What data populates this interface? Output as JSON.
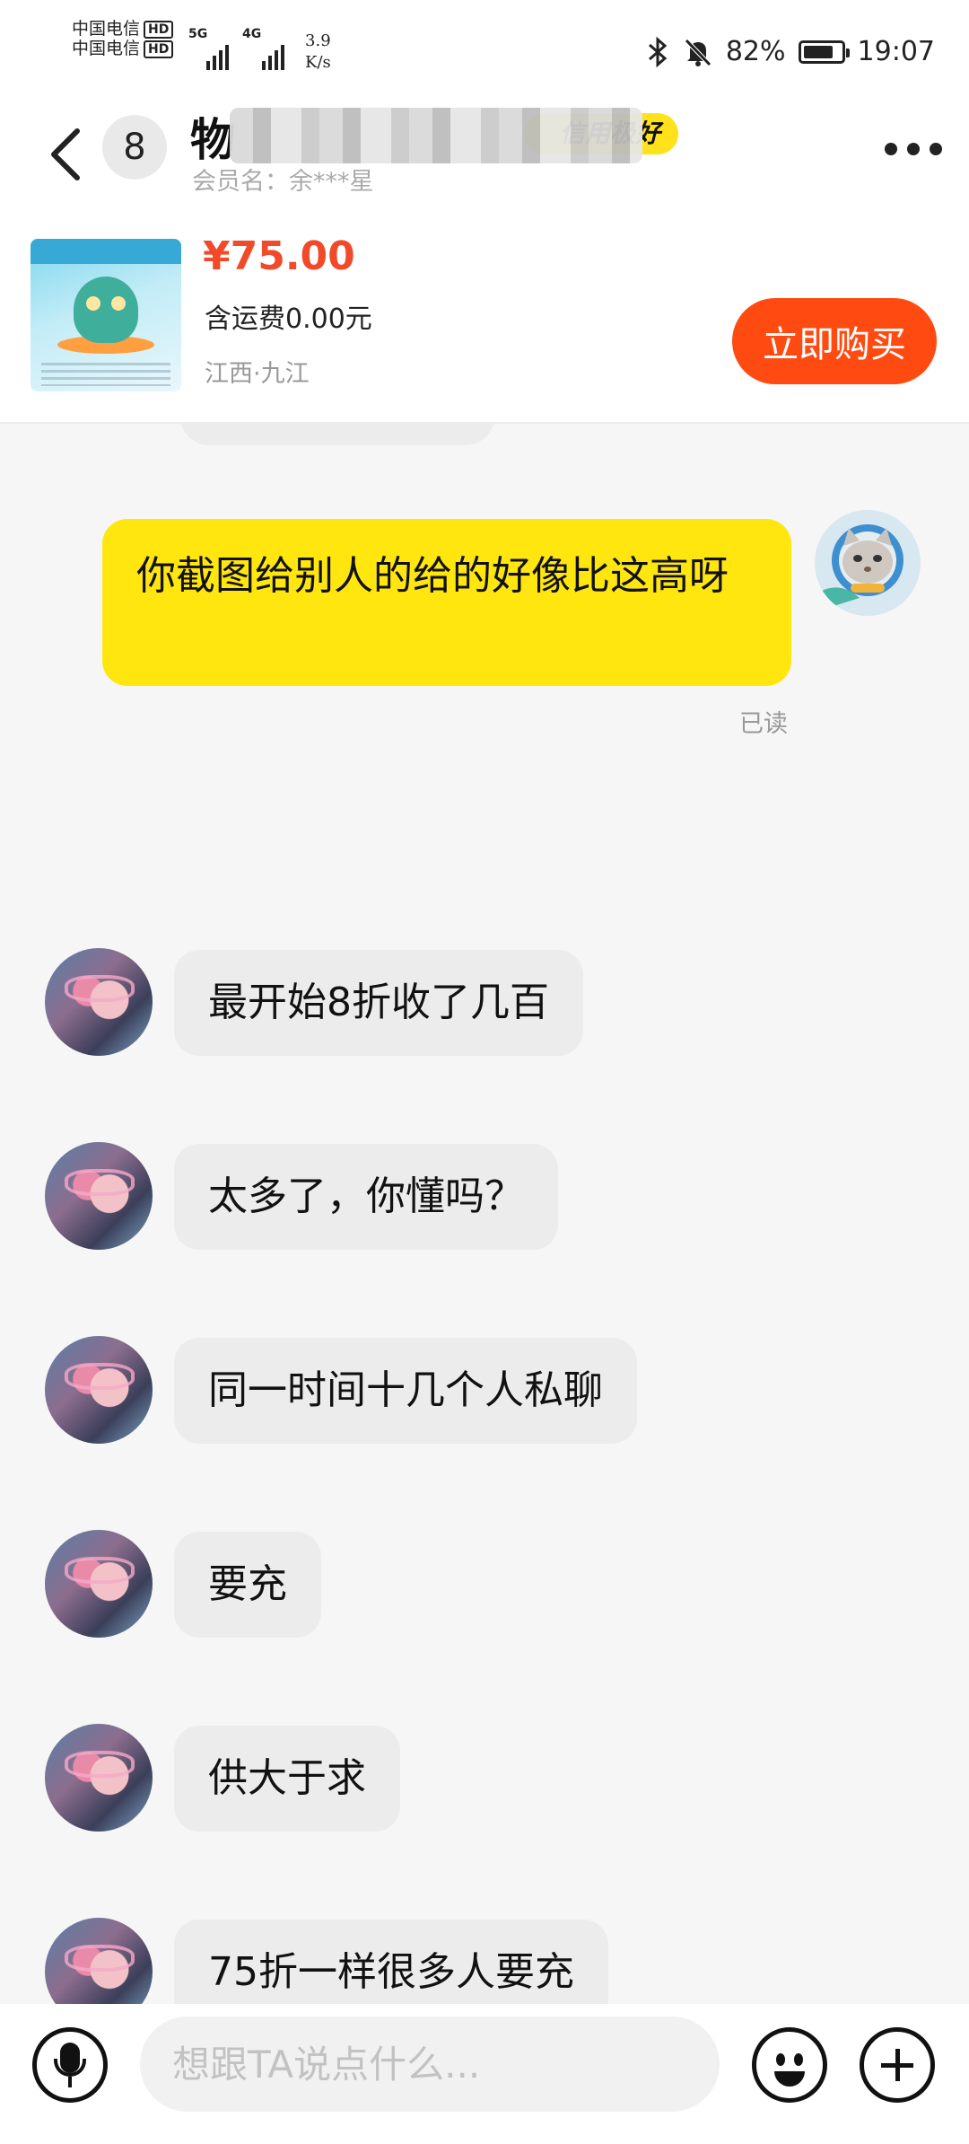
{
  "status_bar": {
    "carrier_1": "中国电信",
    "carrier_2": "中国电信",
    "hd_label": "HD",
    "net_1": "5G",
    "net_2": "4G",
    "speed_value": "3.9",
    "speed_unit": "K/s",
    "battery_level": "82%",
    "battery_fraction": 0.82,
    "time": "19:07"
  },
  "header": {
    "unread_count": "8",
    "title_visible": "物",
    "credit_badge": "信用极好",
    "member_name": "会员名：余***星"
  },
  "product": {
    "price": "¥75.00",
    "shipping": "含运费0.00元",
    "location": "江西·九江",
    "buy_label": "立即购买"
  },
  "chat": {
    "my_message": "你截图给别人的给的好像比这高呀",
    "read_status": "已读",
    "their_messages": [
      "最开始8折收了几百",
      "太多了，你懂吗？",
      "同一时间十几个人私聊",
      "要充",
      "供大于求",
      "75折一样很多人要充"
    ]
  },
  "input_bar": {
    "placeholder": "想跟TA说点什么..."
  },
  "icons": {
    "back": "chevron-left-icon",
    "more": "more-dots-icon",
    "mic": "microphone-icon",
    "emoji": "emoji-smile-icon",
    "plus": "plus-circle-icon",
    "bluetooth": "bluetooth-icon",
    "mute": "bell-off-icon"
  },
  "colors": {
    "accent_yellow": "#ffe60f",
    "buy_button": "#ff4b11",
    "price_red": "#f04a2b",
    "their_bubble": "#ececec"
  }
}
